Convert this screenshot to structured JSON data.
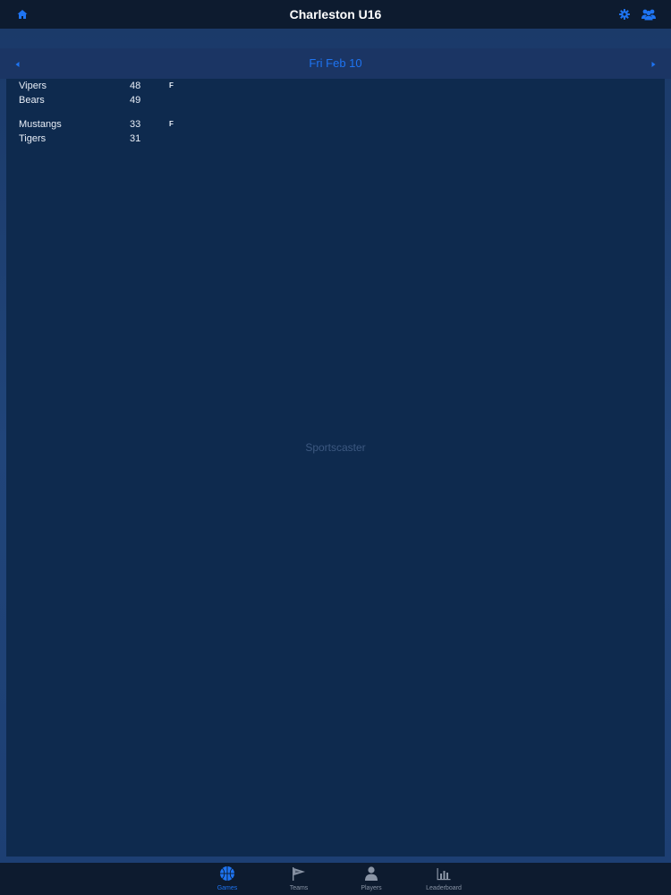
{
  "header": {
    "title": "Charleston U16",
    "icons": [
      "home-icon",
      "gear-icon",
      "team-icon"
    ]
  },
  "datebar": {
    "label": "Fri Feb 10"
  },
  "games": [
    {
      "status": "F",
      "teams": [
        {
          "name": "Vipers",
          "score": "48"
        },
        {
          "name": "Bears",
          "score": "49"
        }
      ]
    },
    {
      "status": "F",
      "teams": [
        {
          "name": "Mustangs",
          "score": "33"
        },
        {
          "name": "Tigers",
          "score": "31"
        }
      ]
    }
  ],
  "watermark": "Sportscaster",
  "tabs": [
    {
      "label": "Games",
      "icon": "basketball-icon",
      "active": true
    },
    {
      "label": "Teams",
      "icon": "pennant-icon",
      "active": false
    },
    {
      "label": "Players",
      "icon": "player-icon",
      "active": false
    },
    {
      "label": "Leaderboard",
      "icon": "bar-chart-icon",
      "active": false
    }
  ],
  "colors": {
    "accent": "#1e74f2",
    "navbar_bg": "#0d1b2f",
    "content_bg": "#0e2a4e",
    "datebar_bg": "#1b3564",
    "inactive_tab": "#8a95a6"
  }
}
